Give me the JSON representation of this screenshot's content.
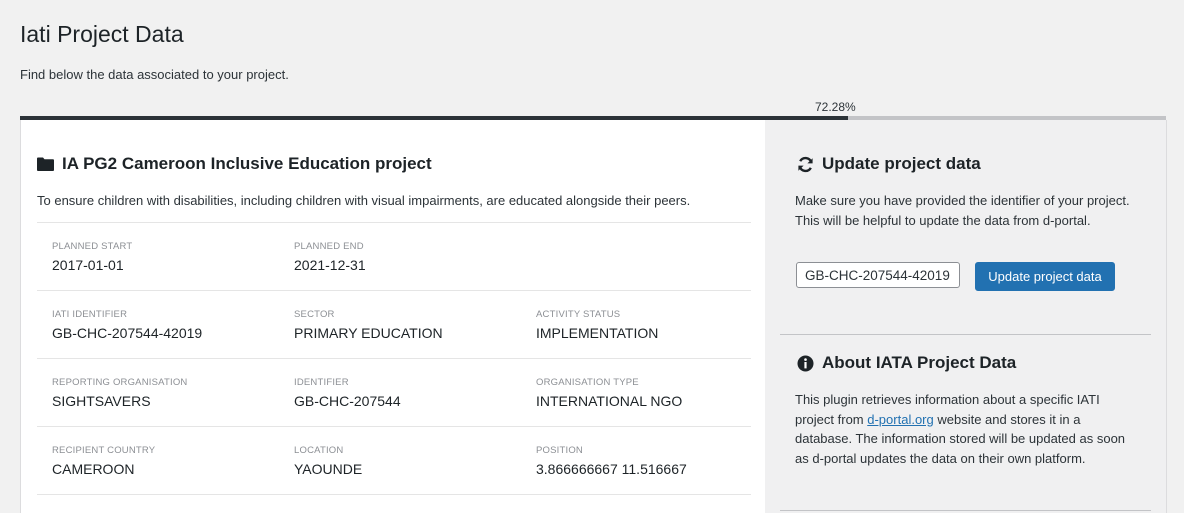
{
  "page": {
    "title": "Iati Project Data",
    "description": "Find below the data associated to your project."
  },
  "progress": {
    "label": "72.28%",
    "value": 0.7228
  },
  "project": {
    "title": "IA PG2 Cameroon Inclusive Education project",
    "description": "To ensure children with disabilities, including children with visual impairments, are educated alongside their peers.",
    "rows": [
      [
        {
          "label": "PLANNED START",
          "value": "2017-01-01"
        },
        {
          "label": "PLANNED END",
          "value": "2021-12-31"
        }
      ],
      [
        {
          "label": "IATI IDENTIFIER",
          "value": "GB-CHC-207544-42019"
        },
        {
          "label": "SECTOR",
          "value": "PRIMARY EDUCATION"
        },
        {
          "label": "ACTIVITY STATUS",
          "value": "IMPLEMENTATION"
        }
      ],
      [
        {
          "label": "REPORTING ORGANISATION",
          "value": "SIGHTSAVERS"
        },
        {
          "label": "IDENTIFIER",
          "value": "GB-CHC-207544"
        },
        {
          "label": "ORGANISATION TYPE",
          "value": "INTERNATIONAL NGO"
        }
      ],
      [
        {
          "label": "RECIPIENT COUNTRY",
          "value": "CAMEROON"
        },
        {
          "label": "LOCATION",
          "value": "YAOUNDE"
        },
        {
          "label": "POSITION",
          "value": "3.866666667 11.516667"
        }
      ]
    ]
  },
  "update": {
    "title": "Update project data",
    "text": "Make sure you have provided the identifier of your project. This will be helpful to update the data from d-portal.",
    "input_value": "GB-CHC-207544-42019",
    "button_label": "Update project data"
  },
  "about": {
    "title": "About IATA Project Data",
    "text_before": "This plugin retrieves information about a specific IATI project from ",
    "link_text": "d-portal.org",
    "text_after": " website and stores it in a database. The information stored will be updated as soon as d-portal updates the data on their own platform."
  },
  "colors": {
    "accent": "#2271b1",
    "progress_fill": "#2c3338",
    "progress_track": "#c3c4c7"
  },
  "icons": {
    "project": "folder-icon",
    "update": "refresh-icon",
    "about": "info-icon"
  }
}
